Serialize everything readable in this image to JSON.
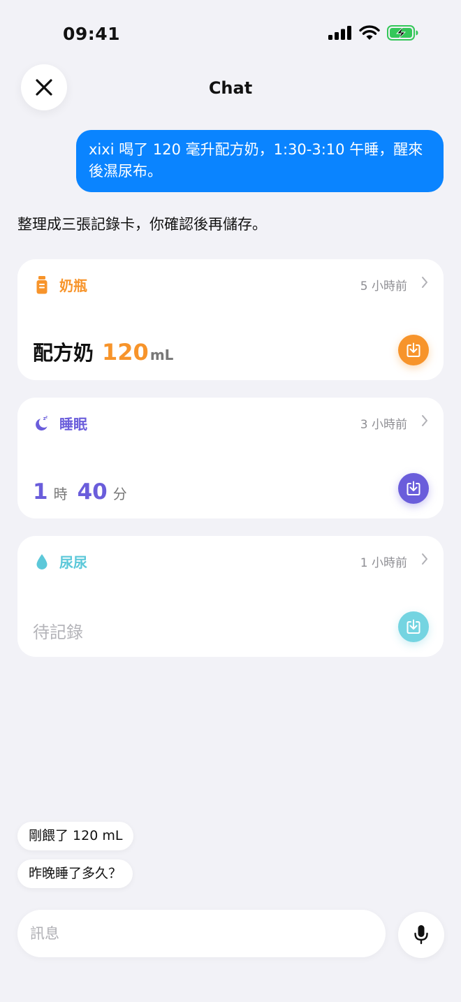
{
  "status": {
    "time": "09:41"
  },
  "nav": {
    "title": "Chat"
  },
  "user_message": "xixi 喝了 120 毫升配方奶，1:30-3:10 午睡，醒來後濕尿布。",
  "assistant_message": "整理成三張記錄卡，你確認後再儲存。",
  "cards": {
    "bottle": {
      "title": "奶瓶",
      "time": "5 小時前",
      "label": "配方奶",
      "amount": "120",
      "unit": "mL",
      "accent": "#f7942b",
      "icon": "bottle-icon"
    },
    "sleep": {
      "title": "睡眠",
      "time": "3 小時前",
      "hours": "1",
      "hours_unit": "時",
      "minutes": "40",
      "minutes_unit": "分",
      "accent": "#6a5ddb",
      "icon": "moon-icon"
    },
    "pee": {
      "title": "尿尿",
      "time": "1 小時前",
      "status": "待記錄",
      "accent": "#5cc8d9",
      "icon": "droplet-icon"
    }
  },
  "suggestions": [
    "剛餵了 120 mL",
    "昨晚睡了多久？"
  ],
  "composer": {
    "placeholder": "訊息"
  },
  "colors": {
    "primary": "#0a84ff",
    "background": "#f2f2f7",
    "battery": "#34c759"
  }
}
